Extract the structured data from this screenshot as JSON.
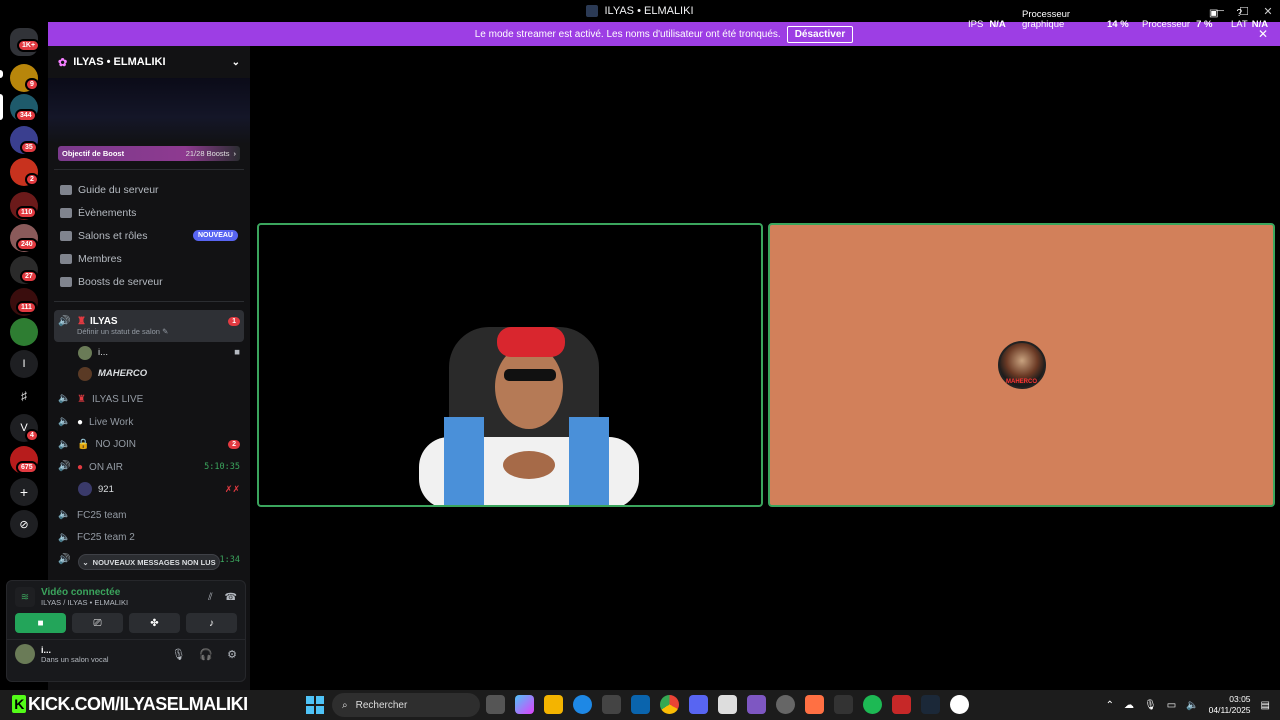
{
  "window": {
    "title": "ILYAS • ELMALIKI"
  },
  "overlay": {
    "ips_label": "IPS",
    "ips_value": "N/A",
    "gpu_label": "Processeur graphique",
    "gpu_value": "14 %",
    "cpu_label": "Processeur",
    "cpu_value": "7 %",
    "lat_label": "LAT",
    "lat_value": "N/A"
  },
  "streamer_bar": {
    "message": "Le mode streamer est activé. Les noms d'utilisateur ont été tronqués.",
    "button": "Désactiver",
    "color": "#9d3ee4"
  },
  "guilds": {
    "badges": [
      "1K+",
      "9",
      "344",
      "35",
      "2",
      "110",
      "240",
      "27",
      "111",
      "4",
      "675"
    ],
    "letters": [
      "I",
      "V"
    ]
  },
  "server": {
    "name": "ILYAS • ELMALIKI",
    "boost_label": "Objectif de Boost",
    "boost_count": "21/28 Boosts",
    "nav": [
      {
        "label": "Guide du serveur"
      },
      {
        "label": "Évènements"
      },
      {
        "label": "Salons et rôles",
        "badge": "NOUVEAU"
      },
      {
        "label": "Membres"
      },
      {
        "label": "Boosts de serveur"
      }
    ]
  },
  "channels": {
    "active": {
      "name": "ILYAS",
      "status": "Définir un statut de salon",
      "count": "1"
    },
    "members": [
      "i...",
      "MAHERCO"
    ],
    "ilyas_live": "ILYAS LIVE",
    "live_work": "Live Work",
    "no_join": "NO JOIN",
    "no_join_count": "2",
    "on_air": "ON AIR",
    "on_air_time": "5:10:35",
    "on_air_member": "921",
    "fc25_team": "FC25 team",
    "fc25_team2": "FC25 team 2",
    "hidden_time": "1:34",
    "unread": "NOUVEAUX MESSAGES NON LUS"
  },
  "voice_panel": {
    "title": "Vidéo connectée",
    "subtitle": "ILYAS / ILYAS • ELMALIKI",
    "user_name": "i...",
    "user_status": "Dans un salon vocal"
  },
  "taskbar": {
    "kick_text": "KICK.COM/ILYASELMALIKI",
    "search_placeholder": "Rechercher",
    "time": "03:05",
    "date": "04/11/2025"
  },
  "colors": {
    "accent_green": "#3ba55d",
    "tile_avatar_bg": "#d2805a",
    "kick_green": "#53fc18"
  }
}
